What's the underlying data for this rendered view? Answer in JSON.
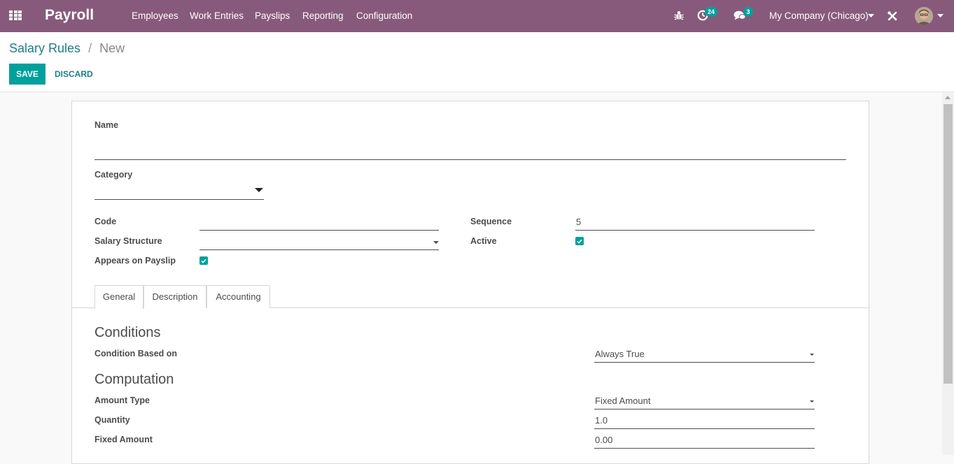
{
  "navbar": {
    "brand": "Payroll",
    "menu": [
      "Employees",
      "Work Entries",
      "Payslips",
      "Reporting",
      "Configuration"
    ],
    "activity_count": "24",
    "message_count": "3",
    "company": "My Company (Chicago)"
  },
  "breadcrumb": {
    "parent": "Salary Rules",
    "separator": "/",
    "current": "New"
  },
  "buttons": {
    "save": "SAVE",
    "discard": "DISCARD"
  },
  "form": {
    "name_label": "Name",
    "name_value": "",
    "category_label": "Category",
    "category_value": "",
    "code_label": "Code",
    "code_value": "",
    "salary_structure_label": "Salary Structure",
    "salary_structure_value": "",
    "appears_on_payslip_label": "Appears on Payslip",
    "appears_on_payslip": true,
    "sequence_label": "Sequence",
    "sequence_value": "5",
    "active_label": "Active",
    "active": true
  },
  "tabs": [
    "General",
    "Description",
    "Accounting"
  ],
  "active_tab": "General",
  "general": {
    "conditions_title": "Conditions",
    "condition_based_on_label": "Condition Based on",
    "condition_based_on_value": "Always True",
    "computation_title": "Computation",
    "amount_type_label": "Amount Type",
    "amount_type_value": "Fixed Amount",
    "quantity_label": "Quantity",
    "quantity_value": "1.0",
    "fixed_amount_label": "Fixed Amount",
    "fixed_amount_value": "0.00"
  },
  "colors": {
    "navbar": "#875a7b",
    "primary": "#00a09d",
    "link": "#1f7e82"
  },
  "icons": [
    "apps-grid-icon",
    "bug-icon",
    "clock-icon",
    "chat-icon",
    "tools-icon",
    "avatar"
  ]
}
